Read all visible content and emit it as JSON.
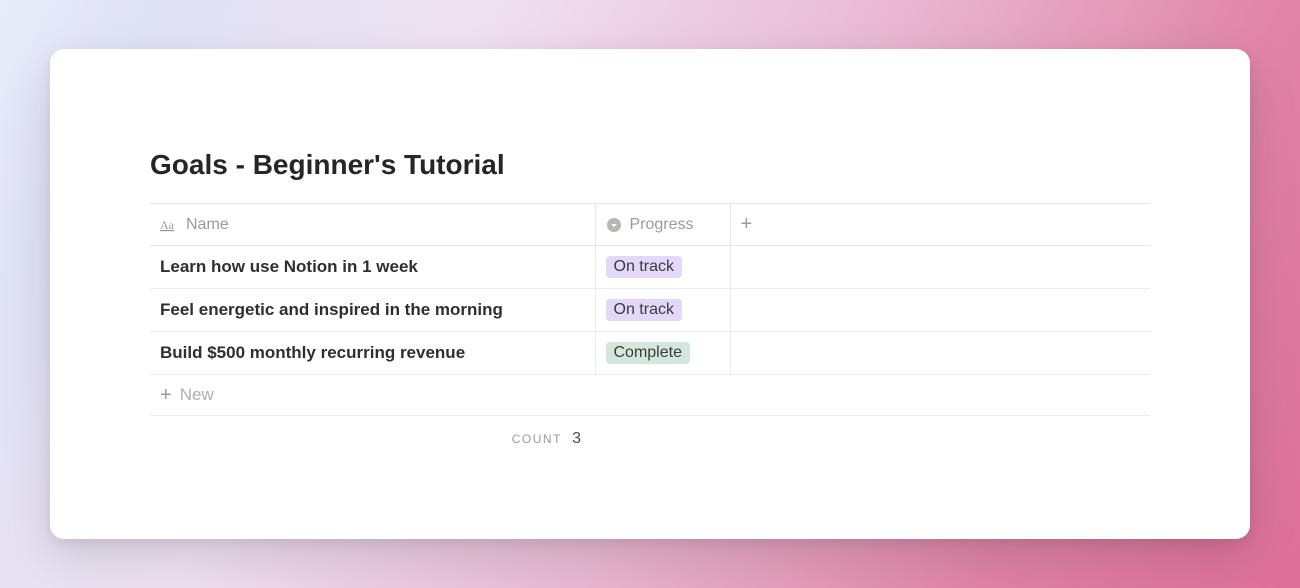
{
  "title": "Goals - Beginner's Tutorial",
  "columns": {
    "name_label": "Name",
    "progress_label": "Progress"
  },
  "rows": [
    {
      "name": "Learn how use Notion in 1 week",
      "progress": "On track",
      "progress_color": "purple"
    },
    {
      "name": "Feel energetic and inspired in the morning",
      "progress": "On track",
      "progress_color": "purple"
    },
    {
      "name": "Build $500 monthly recurring revenue",
      "progress": "Complete",
      "progress_color": "green"
    }
  ],
  "new_row_label": "New",
  "footer": {
    "count_label": "COUNT",
    "count_value": "3"
  },
  "icons": {
    "text_property": "text-property-icon",
    "select_property": "select-property-icon",
    "add": "plus-icon"
  }
}
